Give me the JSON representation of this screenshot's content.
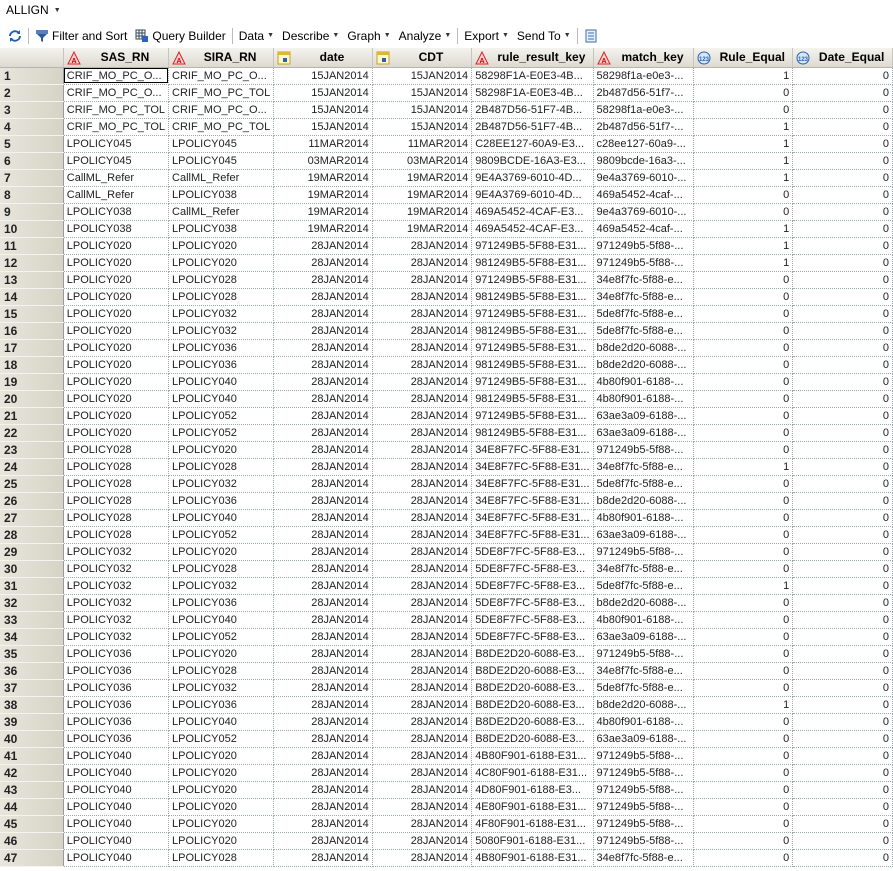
{
  "title": "ALLIGN",
  "toolbar": {
    "filter_sort": "Filter and Sort",
    "query_builder": "Query Builder",
    "data": "Data",
    "describe": "Describe",
    "graph": "Graph",
    "analyze": "Analyze",
    "export": "Export",
    "send_to": "Send To"
  },
  "columns": [
    {
      "name": "SAS_RN",
      "type": "char"
    },
    {
      "name": "SIRA_RN",
      "type": "char"
    },
    {
      "name": "date",
      "type": "date"
    },
    {
      "name": "CDT",
      "type": "date"
    },
    {
      "name": "rule_result_key",
      "type": "char"
    },
    {
      "name": "match_key",
      "type": "char"
    },
    {
      "name": "Rule_Equal",
      "type": "num"
    },
    {
      "name": "Date_Equal",
      "type": "num"
    }
  ],
  "rows": [
    [
      "1",
      "CRIF_MO_PC_O...",
      "CRIF_MO_PC_O...",
      "15JAN2014",
      "15JAN2014",
      "58298F1A-E0E3-4B...",
      "58298f1a-e0e3-...",
      "1",
      "0"
    ],
    [
      "2",
      "CRIF_MO_PC_O...",
      "CRIF_MO_PC_TOL",
      "15JAN2014",
      "15JAN2014",
      "58298F1A-E0E3-4B...",
      "2b487d56-51f7-...",
      "0",
      "0"
    ],
    [
      "3",
      "CRIF_MO_PC_TOL",
      "CRIF_MO_PC_O...",
      "15JAN2014",
      "15JAN2014",
      "2B487D56-51F7-4B...",
      "58298f1a-e0e3-...",
      "0",
      "0"
    ],
    [
      "4",
      "CRIF_MO_PC_TOL",
      "CRIF_MO_PC_TOL",
      "15JAN2014",
      "15JAN2014",
      "2B487D56-51F7-4B...",
      "2b487d56-51f7-...",
      "1",
      "0"
    ],
    [
      "5",
      "LPOLICY045",
      "LPOLICY045",
      "11MAR2014",
      "11MAR2014",
      "C28EE127-60A9-E3...",
      "c28ee127-60a9-...",
      "1",
      "0"
    ],
    [
      "6",
      "LPOLICY045",
      "LPOLICY045",
      "03MAR2014",
      "03MAR2014",
      "9809BCDE-16A3-E3...",
      "9809bcde-16a3-...",
      "1",
      "0"
    ],
    [
      "7",
      "CallML_Refer",
      "CallML_Refer",
      "19MAR2014",
      "19MAR2014",
      "9E4A3769-6010-4D...",
      "9e4a3769-6010-...",
      "1",
      "0"
    ],
    [
      "8",
      "CallML_Refer",
      "LPOLICY038",
      "19MAR2014",
      "19MAR2014",
      "9E4A3769-6010-4D...",
      "469a5452-4caf-...",
      "0",
      "0"
    ],
    [
      "9",
      "LPOLICY038",
      "CallML_Refer",
      "19MAR2014",
      "19MAR2014",
      "469A5452-4CAF-E3...",
      "9e4a3769-6010-...",
      "0",
      "0"
    ],
    [
      "10",
      "LPOLICY038",
      "LPOLICY038",
      "19MAR2014",
      "19MAR2014",
      "469A5452-4CAF-E3...",
      "469a5452-4caf-...",
      "1",
      "0"
    ],
    [
      "11",
      "LPOLICY020",
      "LPOLICY020",
      "28JAN2014",
      "28JAN2014",
      "971249B5-5F88-E31...",
      "971249b5-5f88-...",
      "1",
      "0"
    ],
    [
      "12",
      "LPOLICY020",
      "LPOLICY020",
      "28JAN2014",
      "28JAN2014",
      "981249B5-5F88-E31...",
      "971249b5-5f88-...",
      "1",
      "0"
    ],
    [
      "13",
      "LPOLICY020",
      "LPOLICY028",
      "28JAN2014",
      "28JAN2014",
      "971249B5-5F88-E31...",
      "34e8f7fc-5f88-e...",
      "0",
      "0"
    ],
    [
      "14",
      "LPOLICY020",
      "LPOLICY028",
      "28JAN2014",
      "28JAN2014",
      "981249B5-5F88-E31...",
      "34e8f7fc-5f88-e...",
      "0",
      "0"
    ],
    [
      "15",
      "LPOLICY020",
      "LPOLICY032",
      "28JAN2014",
      "28JAN2014",
      "971249B5-5F88-E31...",
      "5de8f7fc-5f88-e...",
      "0",
      "0"
    ],
    [
      "16",
      "LPOLICY020",
      "LPOLICY032",
      "28JAN2014",
      "28JAN2014",
      "981249B5-5F88-E31...",
      "5de8f7fc-5f88-e...",
      "0",
      "0"
    ],
    [
      "17",
      "LPOLICY020",
      "LPOLICY036",
      "28JAN2014",
      "28JAN2014",
      "971249B5-5F88-E31...",
      "b8de2d20-6088-...",
      "0",
      "0"
    ],
    [
      "18",
      "LPOLICY020",
      "LPOLICY036",
      "28JAN2014",
      "28JAN2014",
      "981249B5-5F88-E31...",
      "b8de2d20-6088-...",
      "0",
      "0"
    ],
    [
      "19",
      "LPOLICY020",
      "LPOLICY040",
      "28JAN2014",
      "28JAN2014",
      "971249B5-5F88-E31...",
      "4b80f901-6188-...",
      "0",
      "0"
    ],
    [
      "20",
      "LPOLICY020",
      "LPOLICY040",
      "28JAN2014",
      "28JAN2014",
      "981249B5-5F88-E31...",
      "4b80f901-6188-...",
      "0",
      "0"
    ],
    [
      "21",
      "LPOLICY020",
      "LPOLICY052",
      "28JAN2014",
      "28JAN2014",
      "971249B5-5F88-E31...",
      "63ae3a09-6188-...",
      "0",
      "0"
    ],
    [
      "22",
      "LPOLICY020",
      "LPOLICY052",
      "28JAN2014",
      "28JAN2014",
      "981249B5-5F88-E31...",
      "63ae3a09-6188-...",
      "0",
      "0"
    ],
    [
      "23",
      "LPOLICY028",
      "LPOLICY020",
      "28JAN2014",
      "28JAN2014",
      "34E8F7FC-5F88-E31...",
      "971249b5-5f88-...",
      "0",
      "0"
    ],
    [
      "24",
      "LPOLICY028",
      "LPOLICY028",
      "28JAN2014",
      "28JAN2014",
      "34E8F7FC-5F88-E31...",
      "34e8f7fc-5f88-e...",
      "1",
      "0"
    ],
    [
      "25",
      "LPOLICY028",
      "LPOLICY032",
      "28JAN2014",
      "28JAN2014",
      "34E8F7FC-5F88-E31...",
      "5de8f7fc-5f88-e...",
      "0",
      "0"
    ],
    [
      "26",
      "LPOLICY028",
      "LPOLICY036",
      "28JAN2014",
      "28JAN2014",
      "34E8F7FC-5F88-E31...",
      "b8de2d20-6088-...",
      "0",
      "0"
    ],
    [
      "27",
      "LPOLICY028",
      "LPOLICY040",
      "28JAN2014",
      "28JAN2014",
      "34E8F7FC-5F88-E31...",
      "4b80f901-6188-...",
      "0",
      "0"
    ],
    [
      "28",
      "LPOLICY028",
      "LPOLICY052",
      "28JAN2014",
      "28JAN2014",
      "34E8F7FC-5F88-E31...",
      "63ae3a09-6188-...",
      "0",
      "0"
    ],
    [
      "29",
      "LPOLICY032",
      "LPOLICY020",
      "28JAN2014",
      "28JAN2014",
      "5DE8F7FC-5F88-E3...",
      "971249b5-5f88-...",
      "0",
      "0"
    ],
    [
      "30",
      "LPOLICY032",
      "LPOLICY028",
      "28JAN2014",
      "28JAN2014",
      "5DE8F7FC-5F88-E3...",
      "34e8f7fc-5f88-e...",
      "0",
      "0"
    ],
    [
      "31",
      "LPOLICY032",
      "LPOLICY032",
      "28JAN2014",
      "28JAN2014",
      "5DE8F7FC-5F88-E3...",
      "5de8f7fc-5f88-e...",
      "1",
      "0"
    ],
    [
      "32",
      "LPOLICY032",
      "LPOLICY036",
      "28JAN2014",
      "28JAN2014",
      "5DE8F7FC-5F88-E3...",
      "b8de2d20-6088-...",
      "0",
      "0"
    ],
    [
      "33",
      "LPOLICY032",
      "LPOLICY040",
      "28JAN2014",
      "28JAN2014",
      "5DE8F7FC-5F88-E3...",
      "4b80f901-6188-...",
      "0",
      "0"
    ],
    [
      "34",
      "LPOLICY032",
      "LPOLICY052",
      "28JAN2014",
      "28JAN2014",
      "5DE8F7FC-5F88-E3...",
      "63ae3a09-6188-...",
      "0",
      "0"
    ],
    [
      "35",
      "LPOLICY036",
      "LPOLICY020",
      "28JAN2014",
      "28JAN2014",
      "B8DE2D20-6088-E3...",
      "971249b5-5f88-...",
      "0",
      "0"
    ],
    [
      "36",
      "LPOLICY036",
      "LPOLICY028",
      "28JAN2014",
      "28JAN2014",
      "B8DE2D20-6088-E3...",
      "34e8f7fc-5f88-e...",
      "0",
      "0"
    ],
    [
      "37",
      "LPOLICY036",
      "LPOLICY032",
      "28JAN2014",
      "28JAN2014",
      "B8DE2D20-6088-E3...",
      "5de8f7fc-5f88-e...",
      "0",
      "0"
    ],
    [
      "38",
      "LPOLICY036",
      "LPOLICY036",
      "28JAN2014",
      "28JAN2014",
      "B8DE2D20-6088-E3...",
      "b8de2d20-6088-...",
      "1",
      "0"
    ],
    [
      "39",
      "LPOLICY036",
      "LPOLICY040",
      "28JAN2014",
      "28JAN2014",
      "B8DE2D20-6088-E3...",
      "4b80f901-6188-...",
      "0",
      "0"
    ],
    [
      "40",
      "LPOLICY036",
      "LPOLICY052",
      "28JAN2014",
      "28JAN2014",
      "B8DE2D20-6088-E3...",
      "63ae3a09-6188-...",
      "0",
      "0"
    ],
    [
      "41",
      "LPOLICY040",
      "LPOLICY020",
      "28JAN2014",
      "28JAN2014",
      "4B80F901-6188-E31...",
      "971249b5-5f88-...",
      "0",
      "0"
    ],
    [
      "42",
      "LPOLICY040",
      "LPOLICY020",
      "28JAN2014",
      "28JAN2014",
      "4C80F901-6188-E31...",
      "971249b5-5f88-...",
      "0",
      "0"
    ],
    [
      "43",
      "LPOLICY040",
      "LPOLICY020",
      "28JAN2014",
      "28JAN2014",
      "4D80F901-6188-E3...",
      "971249b5-5f88-...",
      "0",
      "0"
    ],
    [
      "44",
      "LPOLICY040",
      "LPOLICY020",
      "28JAN2014",
      "28JAN2014",
      "4E80F901-6188-E31...",
      "971249b5-5f88-...",
      "0",
      "0"
    ],
    [
      "45",
      "LPOLICY040",
      "LPOLICY020",
      "28JAN2014",
      "28JAN2014",
      "4F80F901-6188-E31...",
      "971249b5-5f88-...",
      "0",
      "0"
    ],
    [
      "46",
      "LPOLICY040",
      "LPOLICY020",
      "28JAN2014",
      "28JAN2014",
      "5080F901-6188-E31...",
      "971249b5-5f88-...",
      "0",
      "0"
    ],
    [
      "47",
      "LPOLICY040",
      "LPOLICY028",
      "28JAN2014",
      "28JAN2014",
      "4B80F901-6188-E31...",
      "34e8f7fc-5f88-e...",
      "0",
      "0"
    ]
  ]
}
